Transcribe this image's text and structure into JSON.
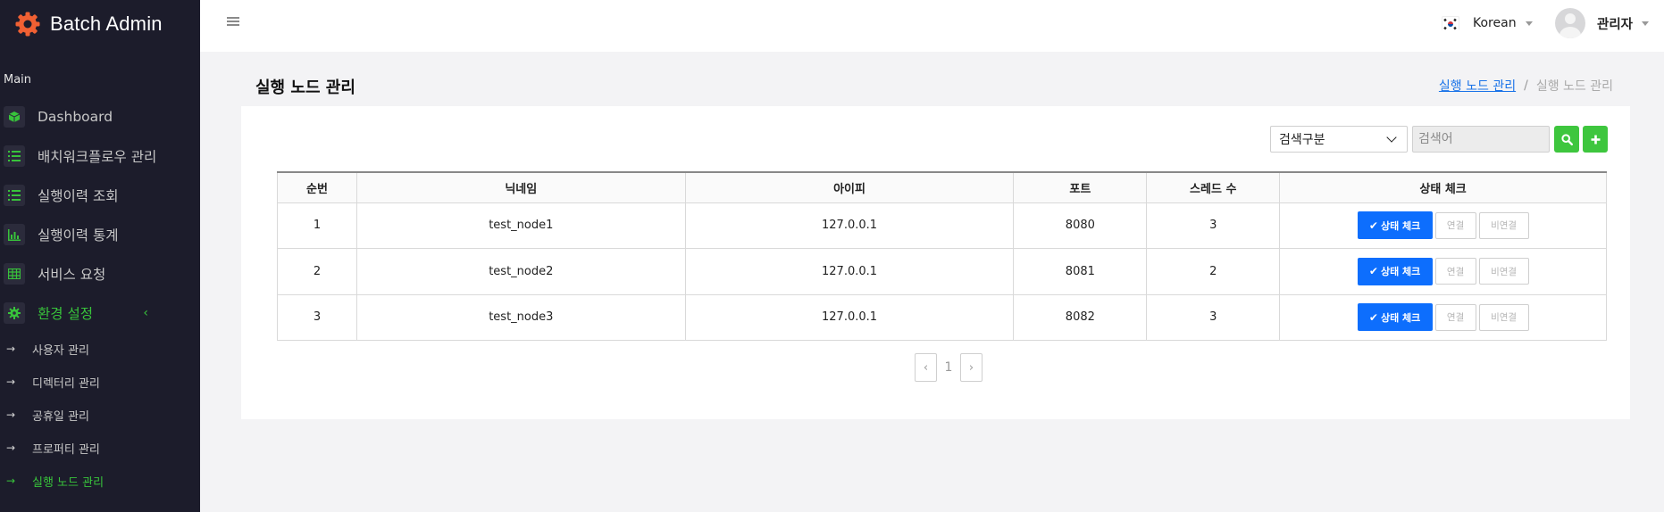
{
  "app": {
    "name": "Batch Admin"
  },
  "sidebar": {
    "section_label": "Main",
    "items": [
      {
        "label": "Dashboard",
        "icon": "cube-icon"
      },
      {
        "label": "배치워크플로우 관리",
        "icon": "list-icon"
      },
      {
        "label": "실행이력 조회",
        "icon": "list-icon"
      },
      {
        "label": "실행이력 통계",
        "icon": "bar-chart-icon"
      },
      {
        "label": "서비스 요청",
        "icon": "table-icon"
      },
      {
        "label": "환경 설정",
        "icon": "gear-icon",
        "active": true
      }
    ],
    "sub_items": [
      {
        "label": "사용자 관리"
      },
      {
        "label": "디렉터리 관리"
      },
      {
        "label": "공휴일 관리"
      },
      {
        "label": "프로퍼티 관리"
      },
      {
        "label": "실행 노드 관리",
        "active": true
      }
    ]
  },
  "topbar": {
    "language": "Korean",
    "user_name": "관리자"
  },
  "page": {
    "title": "실행 노드 관리",
    "breadcrumb": {
      "link": "실행 노드 관리",
      "separator": "/",
      "current": "실행 노드 관리"
    }
  },
  "search": {
    "select_value": "검색구분",
    "placeholder": "검색어"
  },
  "table": {
    "headers": [
      "순번",
      "닉네임",
      "아이피",
      "포트",
      "스레드 수",
      "상태 체크"
    ],
    "rows": [
      {
        "no": "1",
        "nickname": "test_node1",
        "ip": "127.0.0.1",
        "port": "8080",
        "threads": "3"
      },
      {
        "no": "2",
        "nickname": "test_node2",
        "ip": "127.0.0.1",
        "port": "8081",
        "threads": "2"
      },
      {
        "no": "3",
        "nickname": "test_node3",
        "ip": "127.0.0.1",
        "port": "8082",
        "threads": "3"
      }
    ],
    "actions": {
      "check": "상태 체크",
      "connect": "연결",
      "disconnect": "비연결"
    }
  },
  "pagination": {
    "current": "1"
  },
  "colors": {
    "sidebar_bg": "#1c1c2b",
    "accent_green": "#38c33b",
    "primary_blue": "#0d6efd",
    "logo_orange": "#f06033"
  }
}
